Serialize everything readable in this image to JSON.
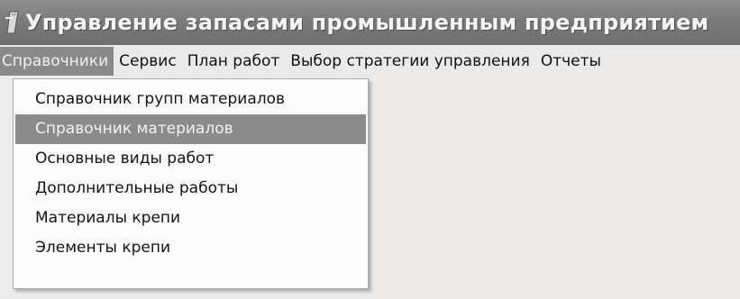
{
  "window": {
    "title": "Управление запасами промышленным предприятием",
    "icon": "app-icon"
  },
  "menubar": {
    "items": [
      {
        "label": "Справочники",
        "active": true
      },
      {
        "label": "Сервис"
      },
      {
        "label": "План работ"
      },
      {
        "label": "Выбор стратегии управления"
      },
      {
        "label": "Отчеты"
      }
    ]
  },
  "dropdown": {
    "items": [
      {
        "label": "Справочник групп материалов"
      },
      {
        "label": "Справочник материалов",
        "selected": true
      },
      {
        "label": "Основные виды работ"
      },
      {
        "label": "Дополнительные работы"
      },
      {
        "label": "Материалы крепи"
      },
      {
        "label": "Элементы крепи"
      }
    ]
  },
  "colors": {
    "titlebar": "#7b7b7b",
    "highlight": "#8a8a8a",
    "menu_background": "#eceae8",
    "dropdown_background": "#fbfbfb"
  }
}
